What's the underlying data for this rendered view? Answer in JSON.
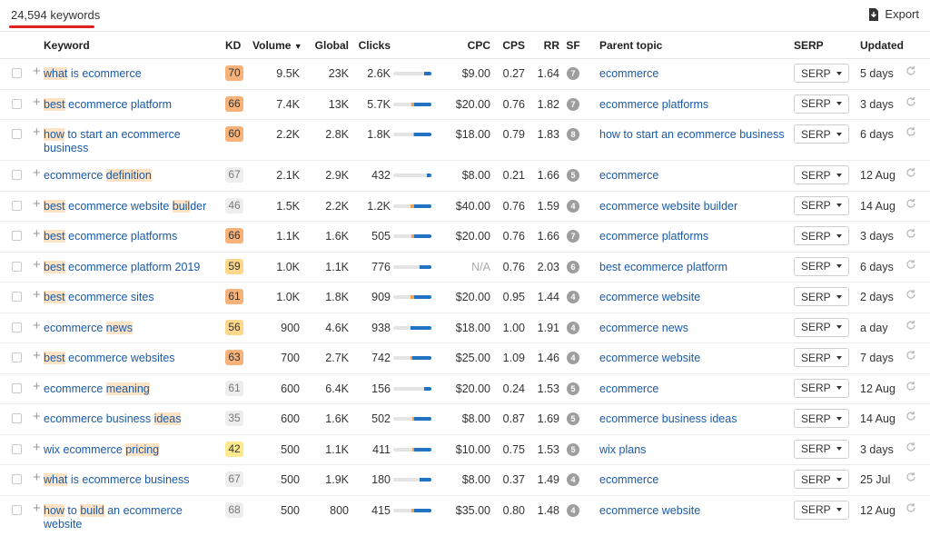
{
  "header": {
    "keyword_count": "24,594 keywords",
    "export_label": "Export"
  },
  "columns": {
    "keyword": "Keyword",
    "kd": "KD",
    "volume": "Volume",
    "global": "Global",
    "clicks": "Clicks",
    "cpc": "CPC",
    "cps": "CPS",
    "rr": "RR",
    "sf": "SF",
    "parent_topic": "Parent topic",
    "serp": "SERP",
    "updated": "Updated"
  },
  "colors": {
    "kd_high": "#f7b27a",
    "kd_mid": "#fdd78a",
    "kd_midlow": "#fde98e",
    "kd_low": "#eeeeee",
    "link": "#1a5aa8",
    "highlight": "#fde2c3",
    "click_bar_organic": "#2272c3",
    "click_bar_paid": "#f0a24a"
  },
  "rows": [
    {
      "kw": [
        {
          "t": "what",
          "h": 1
        },
        {
          "t": " is ecommerce",
          "h": 0
        }
      ],
      "kd": "70",
      "kdc": "high",
      "vol": "9.5K",
      "global": "23K",
      "clicks": "2.6K",
      "cpc": "$9.00",
      "cps": "0.27",
      "rr": "1.64",
      "sf": "7",
      "parent": "ecommerce",
      "serp": "SERP",
      "upd": "5 days",
      "organic_share": 0.2,
      "paid_share": 0,
      "tall": false
    },
    {
      "kw": [
        {
          "t": "best",
          "h": 1
        },
        {
          "t": " ecommerce platform",
          "h": 0
        }
      ],
      "kd": "66",
      "kdc": "high",
      "vol": "7.4K",
      "global": "13K",
      "clicks": "5.7K",
      "cpc": "$20.00",
      "cps": "0.76",
      "rr": "1.82",
      "sf": "7",
      "parent": "ecommerce platforms",
      "serp": "SERP",
      "upd": "3 days",
      "organic_share": 0.45,
      "paid_share": 0.08,
      "tall": false
    },
    {
      "kw": [
        {
          "t": "how",
          "h": 1
        },
        {
          "t": " to start an ecommerce business",
          "h": 0
        }
      ],
      "kd": "60",
      "kdc": "high",
      "vol": "2.2K",
      "global": "2.8K",
      "clicks": "1.8K",
      "cpc": "$18.00",
      "cps": "0.79",
      "rr": "1.83",
      "sf": "8",
      "parent": "how to start an ecommerce business",
      "serp": "SERP",
      "upd": "6 days",
      "organic_share": 0.45,
      "paid_share": 0.03,
      "tall": true
    },
    {
      "kw": [
        {
          "t": "ecommerce ",
          "h": 0
        },
        {
          "t": "definition",
          "h": 1
        }
      ],
      "kd": "67",
      "kdc": "low",
      "vol": "2.1K",
      "global": "2.9K",
      "clicks": "432",
      "cpc": "$8.00",
      "cps": "0.21",
      "rr": "1.66",
      "sf": "5",
      "parent": "ecommerce",
      "serp": "SERP",
      "upd": "12 Aug",
      "organic_share": 0.12,
      "paid_share": 0,
      "tall": false
    },
    {
      "kw": [
        {
          "t": "best",
          "h": 1
        },
        {
          "t": " ecommerce website ",
          "h": 0
        },
        {
          "t": "buil",
          "h": 1
        },
        {
          "t": "der",
          "h": 0
        }
      ],
      "kd": "46",
      "kdc": "low",
      "vol": "1.5K",
      "global": "2.2K",
      "clicks": "1.2K",
      "cpc": "$40.00",
      "cps": "0.76",
      "rr": "1.59",
      "sf": "4",
      "parent": "ecommerce website builder",
      "serp": "SERP",
      "upd": "14 Aug",
      "organic_share": 0.45,
      "paid_share": 0.1,
      "tall": false
    },
    {
      "kw": [
        {
          "t": "best",
          "h": 1
        },
        {
          "t": " ecommerce platforms",
          "h": 0
        }
      ],
      "kd": "66",
      "kdc": "high",
      "vol": "1.1K",
      "global": "1.6K",
      "clicks": "505",
      "cpc": "$20.00",
      "cps": "0.76",
      "rr": "1.66",
      "sf": "7",
      "parent": "ecommerce platforms",
      "serp": "SERP",
      "upd": "3 days",
      "organic_share": 0.45,
      "paid_share": 0.06,
      "tall": false
    },
    {
      "kw": [
        {
          "t": "best",
          "h": 1
        },
        {
          "t": " ecommerce platform 2019",
          "h": 0
        }
      ],
      "kd": "59",
      "kdc": "mid",
      "vol": "1.0K",
      "global": "1.1K",
      "clicks": "776",
      "cpc": "N/A",
      "cps": "0.76",
      "rr": "2.03",
      "sf": "6",
      "parent": "best ecommerce platform",
      "serp": "SERP",
      "upd": "6 days",
      "organic_share": 0.3,
      "paid_share": 0,
      "tall": false
    },
    {
      "kw": [
        {
          "t": "best",
          "h": 1
        },
        {
          "t": " ecommerce sites",
          "h": 0
        }
      ],
      "kd": "61",
      "kdc": "high",
      "vol": "1.0K",
      "global": "1.8K",
      "clicks": "909",
      "cpc": "$20.00",
      "cps": "0.95",
      "rr": "1.44",
      "sf": "4",
      "parent": "ecommerce website",
      "serp": "SERP",
      "upd": "2 days",
      "organic_share": 0.45,
      "paid_share": 0.1,
      "tall": false
    },
    {
      "kw": [
        {
          "t": "ecommerce ",
          "h": 0
        },
        {
          "t": "news",
          "h": 1
        }
      ],
      "kd": "56",
      "kdc": "mid",
      "vol": "900",
      "global": "4.6K",
      "clicks": "938",
      "cpc": "$18.00",
      "cps": "1.00",
      "rr": "1.91",
      "sf": "4",
      "parent": "ecommerce news",
      "serp": "SERP",
      "upd": "a day",
      "organic_share": 0.55,
      "paid_share": 0,
      "tall": false
    },
    {
      "kw": [
        {
          "t": "best",
          "h": 1
        },
        {
          "t": " ecommerce websites",
          "h": 0
        }
      ],
      "kd": "63",
      "kdc": "high",
      "vol": "700",
      "global": "2.7K",
      "clicks": "742",
      "cpc": "$25.00",
      "cps": "1.09",
      "rr": "1.46",
      "sf": "4",
      "parent": "ecommerce website",
      "serp": "SERP",
      "upd": "7 days",
      "organic_share": 0.5,
      "paid_share": 0.05,
      "tall": false
    },
    {
      "kw": [
        {
          "t": "ecommerce ",
          "h": 0
        },
        {
          "t": "meaning",
          "h": 1
        }
      ],
      "kd": "61",
      "kdc": "low",
      "vol": "600",
      "global": "6.4K",
      "clicks": "156",
      "cpc": "$20.00",
      "cps": "0.24",
      "rr": "1.53",
      "sf": "5",
      "parent": "ecommerce",
      "serp": "SERP",
      "upd": "12 Aug",
      "organic_share": 0.2,
      "paid_share": 0,
      "tall": false
    },
    {
      "kw": [
        {
          "t": "ecommerce business ",
          "h": 0
        },
        {
          "t": "ideas",
          "h": 1
        }
      ],
      "kd": "35",
      "kdc": "low",
      "vol": "600",
      "global": "1.6K",
      "clicks": "502",
      "cpc": "$8.00",
      "cps": "0.87",
      "rr": "1.69",
      "sf": "5",
      "parent": "ecommerce business ideas",
      "serp": "SERP",
      "upd": "14 Aug",
      "organic_share": 0.45,
      "paid_share": 0.04,
      "tall": false
    },
    {
      "kw": [
        {
          "t": "wix ecommerce ",
          "h": 0
        },
        {
          "t": "pricing",
          "h": 1
        }
      ],
      "kd": "42",
      "kdc": "midlow",
      "vol": "500",
      "global": "1.1K",
      "clicks": "411",
      "cpc": "$10.00",
      "cps": "0.75",
      "rr": "1.53",
      "sf": "5",
      "parent": "wix plans",
      "serp": "SERP",
      "upd": "3 days",
      "organic_share": 0.45,
      "paid_share": 0.05,
      "tall": false
    },
    {
      "kw": [
        {
          "t": "what",
          "h": 1
        },
        {
          "t": " is ecommerce business",
          "h": 0
        }
      ],
      "kd": "67",
      "kdc": "low",
      "vol": "500",
      "global": "1.9K",
      "clicks": "180",
      "cpc": "$8.00",
      "cps": "0.37",
      "rr": "1.49",
      "sf": "4",
      "parent": "ecommerce",
      "serp": "SERP",
      "upd": "25 Jul",
      "organic_share": 0.3,
      "paid_share": 0,
      "tall": false
    },
    {
      "kw": [
        {
          "t": "how",
          "h": 1
        },
        {
          "t": " to ",
          "h": 0
        },
        {
          "t": "build",
          "h": 1
        },
        {
          "t": " an ecommerce website",
          "h": 0
        }
      ],
      "kd": "68",
      "kdc": "low",
      "vol": "500",
      "global": "800",
      "clicks": "415",
      "cpc": "$35.00",
      "cps": "0.80",
      "rr": "1.48",
      "sf": "4",
      "parent": "ecommerce website",
      "serp": "SERP",
      "upd": "12 Aug",
      "organic_share": 0.45,
      "paid_share": 0.08,
      "tall": true
    }
  ]
}
